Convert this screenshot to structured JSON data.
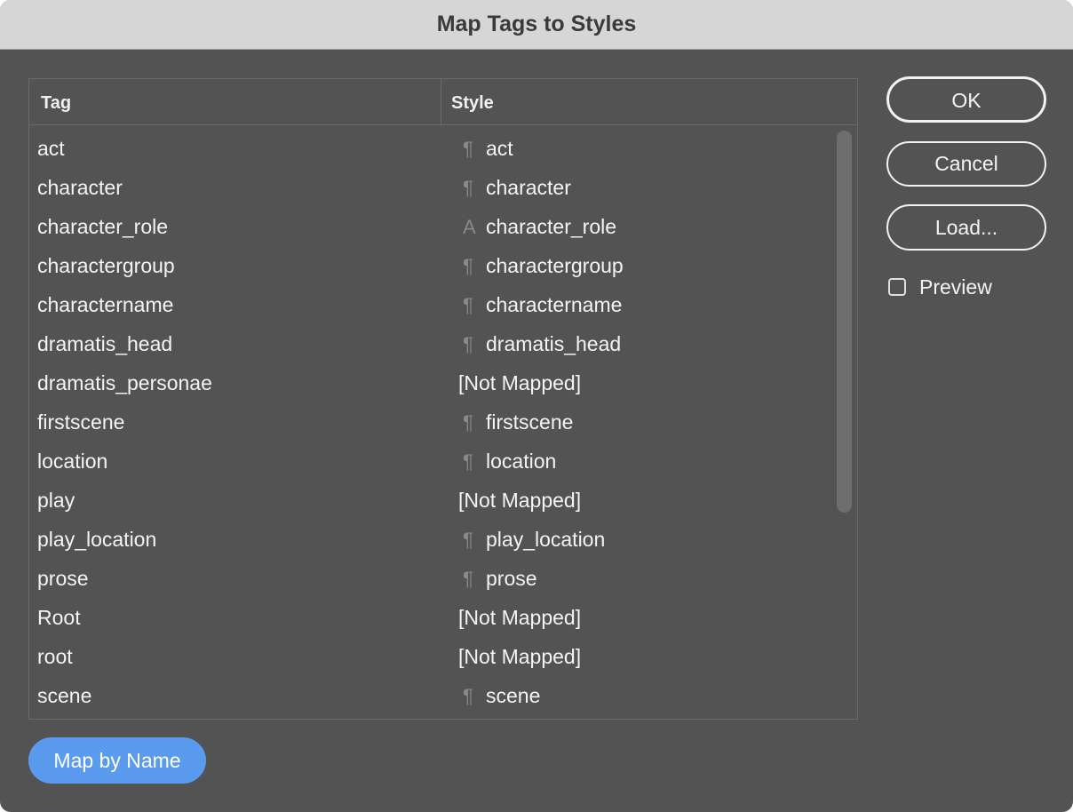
{
  "window": {
    "title": "Map Tags to Styles"
  },
  "table": {
    "columns": {
      "tag": "Tag",
      "style": "Style"
    },
    "rows": [
      {
        "tag": "act",
        "style": "act",
        "icon": "paragraph-style-icon",
        "glyph": "¶"
      },
      {
        "tag": "character",
        "style": "character",
        "icon": "paragraph-style-icon",
        "glyph": "¶"
      },
      {
        "tag": "character_role",
        "style": "character_role",
        "icon": "character-style-icon",
        "glyph": "A"
      },
      {
        "tag": "charactergroup",
        "style": "charactergroup",
        "icon": "paragraph-style-icon",
        "glyph": "¶"
      },
      {
        "tag": "charactername",
        "style": "charactername",
        "icon": "paragraph-style-icon",
        "glyph": "¶"
      },
      {
        "tag": "dramatis_head",
        "style": "dramatis_head",
        "icon": "paragraph-style-icon",
        "glyph": "¶"
      },
      {
        "tag": "dramatis_personae",
        "style": "[Not Mapped]",
        "icon": "",
        "glyph": ""
      },
      {
        "tag": "firstscene",
        "style": "firstscene",
        "icon": "paragraph-style-icon",
        "glyph": "¶"
      },
      {
        "tag": "location",
        "style": "location",
        "icon": "paragraph-style-icon",
        "glyph": "¶"
      },
      {
        "tag": "play",
        "style": "[Not Mapped]",
        "icon": "",
        "glyph": ""
      },
      {
        "tag": "play_location",
        "style": "play_location",
        "icon": "paragraph-style-icon",
        "glyph": "¶"
      },
      {
        "tag": "prose",
        "style": "prose",
        "icon": "paragraph-style-icon",
        "glyph": "¶"
      },
      {
        "tag": "Root",
        "style": "[Not Mapped]",
        "icon": "",
        "glyph": ""
      },
      {
        "tag": "root",
        "style": "[Not Mapped]",
        "icon": "",
        "glyph": ""
      },
      {
        "tag": "scene",
        "style": "scene",
        "icon": "paragraph-style-icon",
        "glyph": "¶"
      }
    ]
  },
  "buttons": {
    "ok": "OK",
    "cancel": "Cancel",
    "load": "Load...",
    "map_by_name": "Map by Name"
  },
  "preview": {
    "label": "Preview",
    "checked": false
  },
  "colors": {
    "dialog_bg": "#535353",
    "titlebar_bg": "#d6d6d6",
    "accent": "#5b9bee",
    "text": "#f4f4f4"
  }
}
